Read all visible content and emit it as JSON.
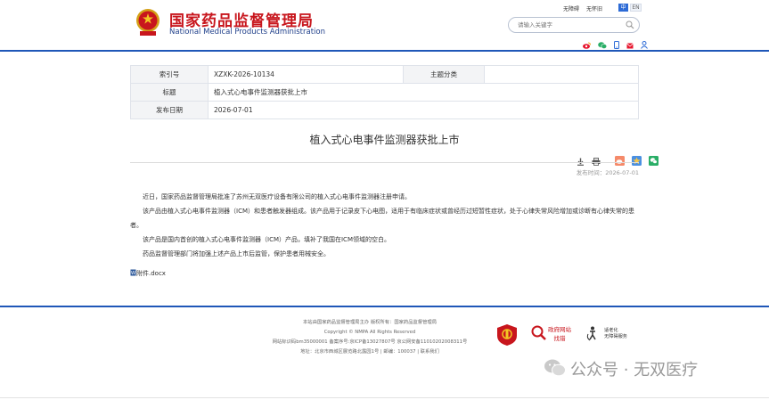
{
  "header": {
    "logo_cn": "国家药品监督管理局",
    "logo_en": "National Medical Products Administration",
    "links": [
      "无障碍",
      "无怀旧"
    ],
    "lang_zh": "中",
    "lang_en": "EN",
    "search_placeholder": "请输入关键字",
    "social_icons": [
      "weibo-icon",
      "wechat-icon",
      "mobile-icon",
      "mail-icon",
      "user-icon"
    ]
  },
  "meta": {
    "index_label": "索引号",
    "index_value": "XZXK-2026-10134",
    "category_label": "主题分类",
    "category_value": "",
    "title_label": "标题",
    "title_value": "植入式心电事件监测器获批上市",
    "date_label": "发布日期",
    "date_value": "2026-07-01"
  },
  "article": {
    "title": "植入式心电事件监测器获批上市",
    "pub_time": "发布时间：2026-07-01",
    "paragraphs": [
      "近日，国家药品监督管理局批准了苏州无双医疗设备有限公司的植入式心电事件监测器注册申请。",
      "该产品由植入式心电事件监测器（ICM）和患者触发器组成。该产品用于记录皮下心电图，适用于有临床症状或曾经历过短暂性症状，处于心律失常风险增加或诊断有心律失常的患者。",
      "该产品是国内首创的植入式心电事件监测器（ICM）产品，填补了我国在ICM领域的空白。",
      "药品监督管理部门将加强上述产品上市后监管，保护患者用械安全。"
    ],
    "attachment": "附件.docx"
  },
  "footer": {
    "line1": "本站由国家药品监督管理局主办 版权所有：国家药品监督管理局",
    "line2": "Copyright © NMPA All Rights Reserved",
    "line3": "网站标识码bm35000001  备案序号:京ICP备13027807号  京公网安备11010202008311号",
    "line4": "地址：北京市西城区展览路北露园1号 | 邮编：100037 | 联系我们",
    "badge_gov": "政府网站",
    "badge_gov_sub": "找错",
    "badge_aged": "适老化",
    "badge_aged_sub": "无障碍服务"
  },
  "watermark": {
    "text": "公众号 · 无双医疗"
  },
  "colors": {
    "brand_red": "#c8161d",
    "brand_blue": "#1f57b8"
  }
}
